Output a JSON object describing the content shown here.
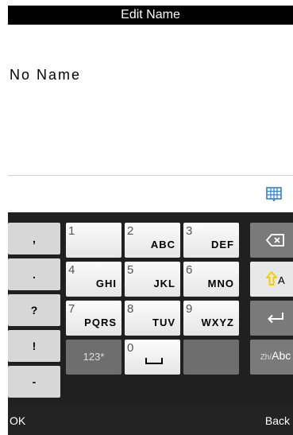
{
  "header": {
    "title": "Edit Name"
  },
  "editor": {
    "value": "No Name"
  },
  "keyboard": {
    "symbols": [
      ",",
      ".",
      "?",
      "!",
      "-"
    ],
    "rows": [
      [
        {
          "digit": "1",
          "letters": ""
        },
        {
          "digit": "2",
          "letters": "ABC"
        },
        {
          "digit": "3",
          "letters": "DEF"
        }
      ],
      [
        {
          "digit": "4",
          "letters": "GHI"
        },
        {
          "digit": "5",
          "letters": "JKL"
        },
        {
          "digit": "6",
          "letters": "MNO"
        }
      ],
      [
        {
          "digit": "7",
          "letters": "PQRS"
        },
        {
          "digit": "8",
          "letters": "TUV"
        },
        {
          "digit": "9",
          "letters": "WXYZ"
        }
      ],
      [
        {
          "label": "123*"
        },
        {
          "digit": "0",
          "icon": "space-icon"
        },
        {
          "label": ""
        }
      ]
    ],
    "side_keys": {
      "backspace_icon": "backspace-icon",
      "shift_label": "A",
      "enter_icon": "enter-icon",
      "lang_label_small": "Zh/",
      "lang_label_main": "Abc"
    }
  },
  "softkeys": {
    "left": "OK",
    "right": "Back"
  },
  "colors": {
    "accent": "#2f7fd6",
    "shift_arrow": "#f2d000"
  }
}
